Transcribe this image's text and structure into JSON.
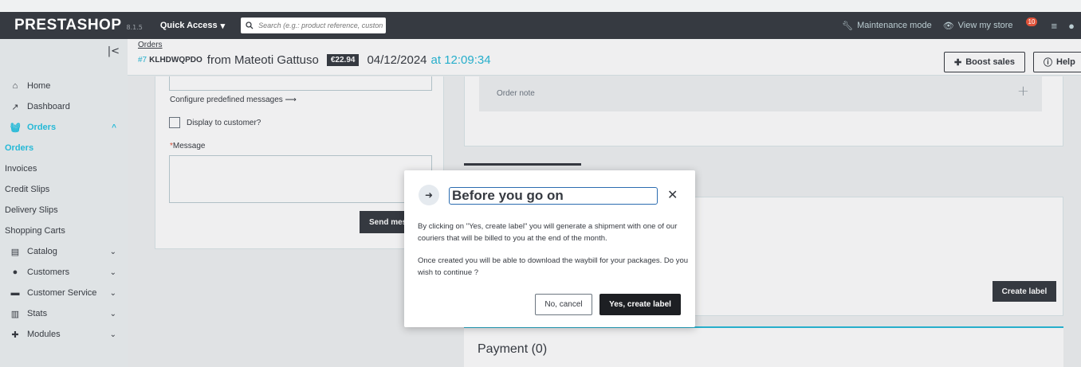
{
  "topbar": {
    "logo": "PRESTASHOP",
    "version": "8.1.5",
    "quick_access": "Quick Access",
    "search_placeholder": "Search (e.g.: product reference, custon",
    "maintenance": "Maintenance mode",
    "view_store": "View my store",
    "notif_count": "10"
  },
  "sidebar": {
    "items": [
      {
        "label": "Home",
        "icon": "home-icon"
      },
      {
        "label": "Dashboard",
        "icon": "trending-icon"
      },
      {
        "label": "Orders",
        "icon": "basket-icon"
      },
      {
        "label": "Catalog",
        "icon": "store-icon"
      },
      {
        "label": "Customers",
        "icon": "account-icon"
      },
      {
        "label": "Customer Service",
        "icon": "chat-icon"
      },
      {
        "label": "Stats",
        "icon": "chart-icon"
      },
      {
        "label": "Modules",
        "icon": "puzzle-icon"
      }
    ],
    "orders_sub": [
      "Orders",
      "Invoices",
      "Credit Slips",
      "Delivery Slips",
      "Shopping Carts"
    ]
  },
  "header": {
    "breadcrumb": "Orders",
    "order_ref": "#7",
    "order_code": "KLHDWQPDO",
    "from_text": "from Mateoti Gattuso",
    "price": "€22.94",
    "date": "04/12/2024",
    "time": "at 12:09:34",
    "boost_label": "Boost sales",
    "help_label": "Help"
  },
  "messages": {
    "configure": "Configure predefined messages ⟶",
    "display_customer": "Display to customer?",
    "message_label": "Message",
    "required_mark": "*",
    "send_label": "Send mes"
  },
  "right": {
    "order_note": "Order note",
    "create_label": "Create label",
    "payment_title": "Payment (0)"
  },
  "modal": {
    "title": "Before you go on",
    "para1": "By clicking on \"Yes, create label\" you will generate a shipment with one of our couriers that will be billed to you at the end of the month.",
    "para2": "Once created you will be able to download the waybill for your packages. Do you wish to continue ?",
    "cancel": "No, cancel",
    "confirm": "Yes, create label"
  },
  "colors": {
    "accent": "#25b9d7",
    "topbar": "#363a41",
    "badge": "#e0533a"
  }
}
